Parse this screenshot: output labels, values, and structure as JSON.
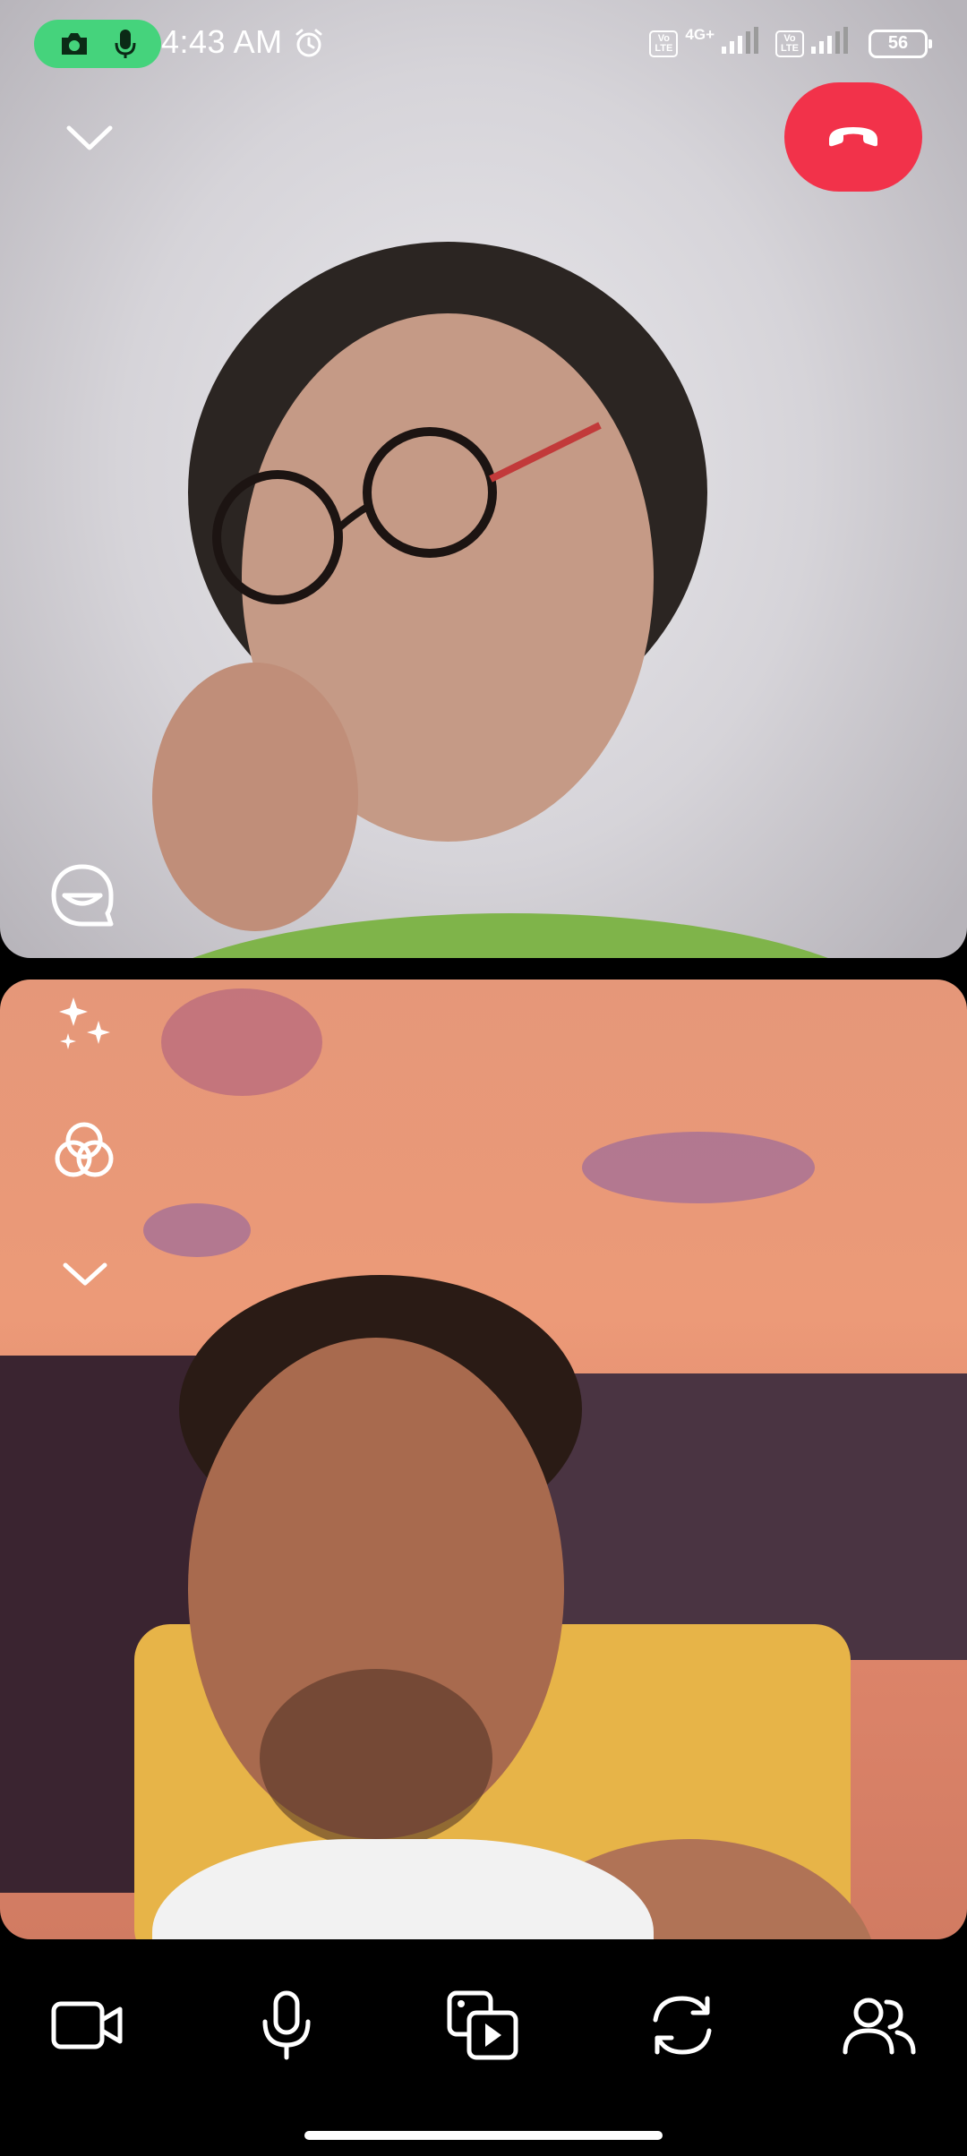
{
  "status_bar": {
    "time": "4:43 AM",
    "network_type": "4G+",
    "volte_1": "Vo LTE",
    "volte_2": "Vo LTE",
    "battery": "56"
  },
  "colors": {
    "end_call": "#f2324a",
    "recording_pill": "#45d37c",
    "toolbar_bg": "#000000"
  },
  "remote_tile": {
    "collapse_icon": "chevron-down-icon",
    "reaction_icon": "chat-face-icon",
    "end_call_icon": "phone-hangup-icon"
  },
  "local_tile": {
    "effects_icon": "sparkles-icon",
    "filters_icon": "color-circles-icon",
    "more_icon": "chevron-down-icon"
  },
  "toolbar": {
    "items": [
      {
        "name": "camera-toggle",
        "icon": "video-camera-icon"
      },
      {
        "name": "microphone-toggle",
        "icon": "microphone-icon"
      },
      {
        "name": "share-media",
        "icon": "media-share-icon"
      },
      {
        "name": "switch-camera",
        "icon": "camera-flip-icon"
      },
      {
        "name": "participants",
        "icon": "people-icon"
      }
    ]
  }
}
